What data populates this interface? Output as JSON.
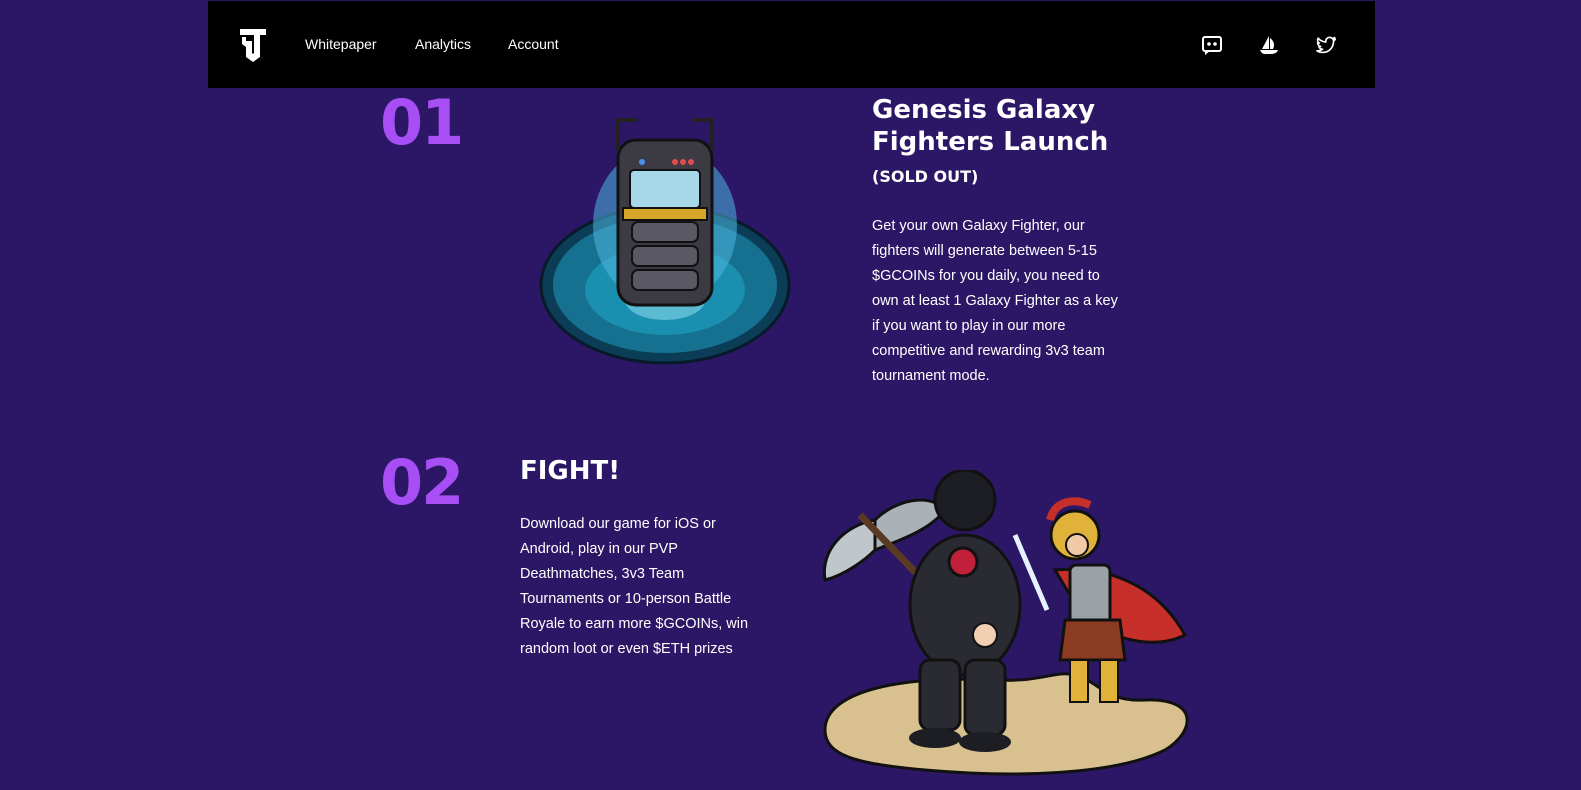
{
  "nav": {
    "links": [
      {
        "label": "Whitepaper"
      },
      {
        "label": "Analytics"
      },
      {
        "label": "Account"
      }
    ],
    "social": [
      "discord-icon",
      "opensea-icon",
      "twitter-icon"
    ]
  },
  "steps": [
    {
      "number": "01",
      "title": "Genesis Galaxy Fighters Launch",
      "subtitle": "(SOLD OUT)",
      "body": "Get your own Galaxy Fighter, our fighters will generate between 5-15 $GCOINs for you daily, you need to own at least 1 Galaxy Fighter as a key if you want to play in our more competitive and rewarding 3v3 team tournament mode."
    },
    {
      "number": "02",
      "title": "FIGHT!",
      "body": "Download our game for iOS or Android, play in our PVP Deathmatches, 3v3 Team Tournaments or 10-person Battle Royale to earn more $GCOINs, win random loot or even $ETH prizes"
    }
  ],
  "colors": {
    "background": "#2c1766",
    "navbar": "#000000",
    "accent": "#a84ef5"
  }
}
